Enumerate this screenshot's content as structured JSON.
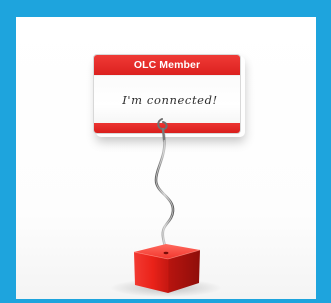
{
  "image": {
    "background_color": "#1ea4dd",
    "subject": {
      "card": {
        "header_text": "OLC Member",
        "message_text": "I'm connected!",
        "accent_color": "#e3231f"
      },
      "stand": {
        "base_color": "#e8221c",
        "wire_color": "#8a8a8a"
      }
    }
  }
}
